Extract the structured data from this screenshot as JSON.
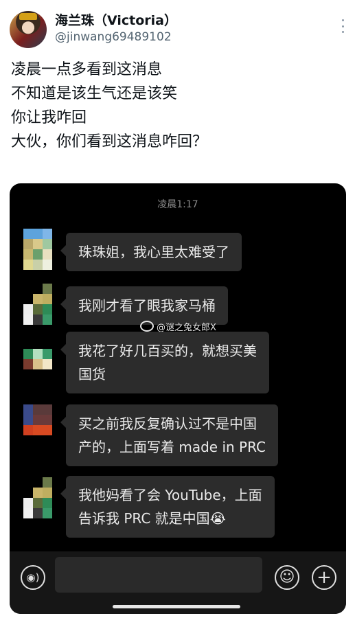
{
  "author": {
    "display_name": "海兰珠（Victoria）",
    "handle": "@jinwang69489102"
  },
  "tweet": {
    "lines": [
      "凌晨一点多看到这消息",
      "不知道是该生气还是该笑",
      "你让我咋回",
      "大伙，你们看到这消息咋回？"
    ]
  },
  "chat_screenshot": {
    "time": "凌晨1:17",
    "watermark": "@谜之兔女郎X",
    "messages": [
      {
        "lines": [
          "珠珠姐，我心里太难受了"
        ]
      },
      {
        "lines": [
          "我刚才看了眼我家马桶"
        ]
      },
      {
        "lines": [
          "我花了好几百买的，就想买美",
          "国货"
        ]
      },
      {
        "lines": [
          "买之前我反复确认过不是中国",
          "产的，上面写着 made in PRC"
        ]
      },
      {
        "lines": [
          "我他妈看了会 YouTube，上面",
          "告诉我 PRC 就是中国😭"
        ]
      }
    ],
    "input_icons": [
      "voice-icon",
      "emoji-icon",
      "plus-icon"
    ]
  },
  "colors": {
    "chat_bg": "#000000",
    "bubble_bg": "#2c2c2c",
    "handle_gray": "#536471"
  }
}
